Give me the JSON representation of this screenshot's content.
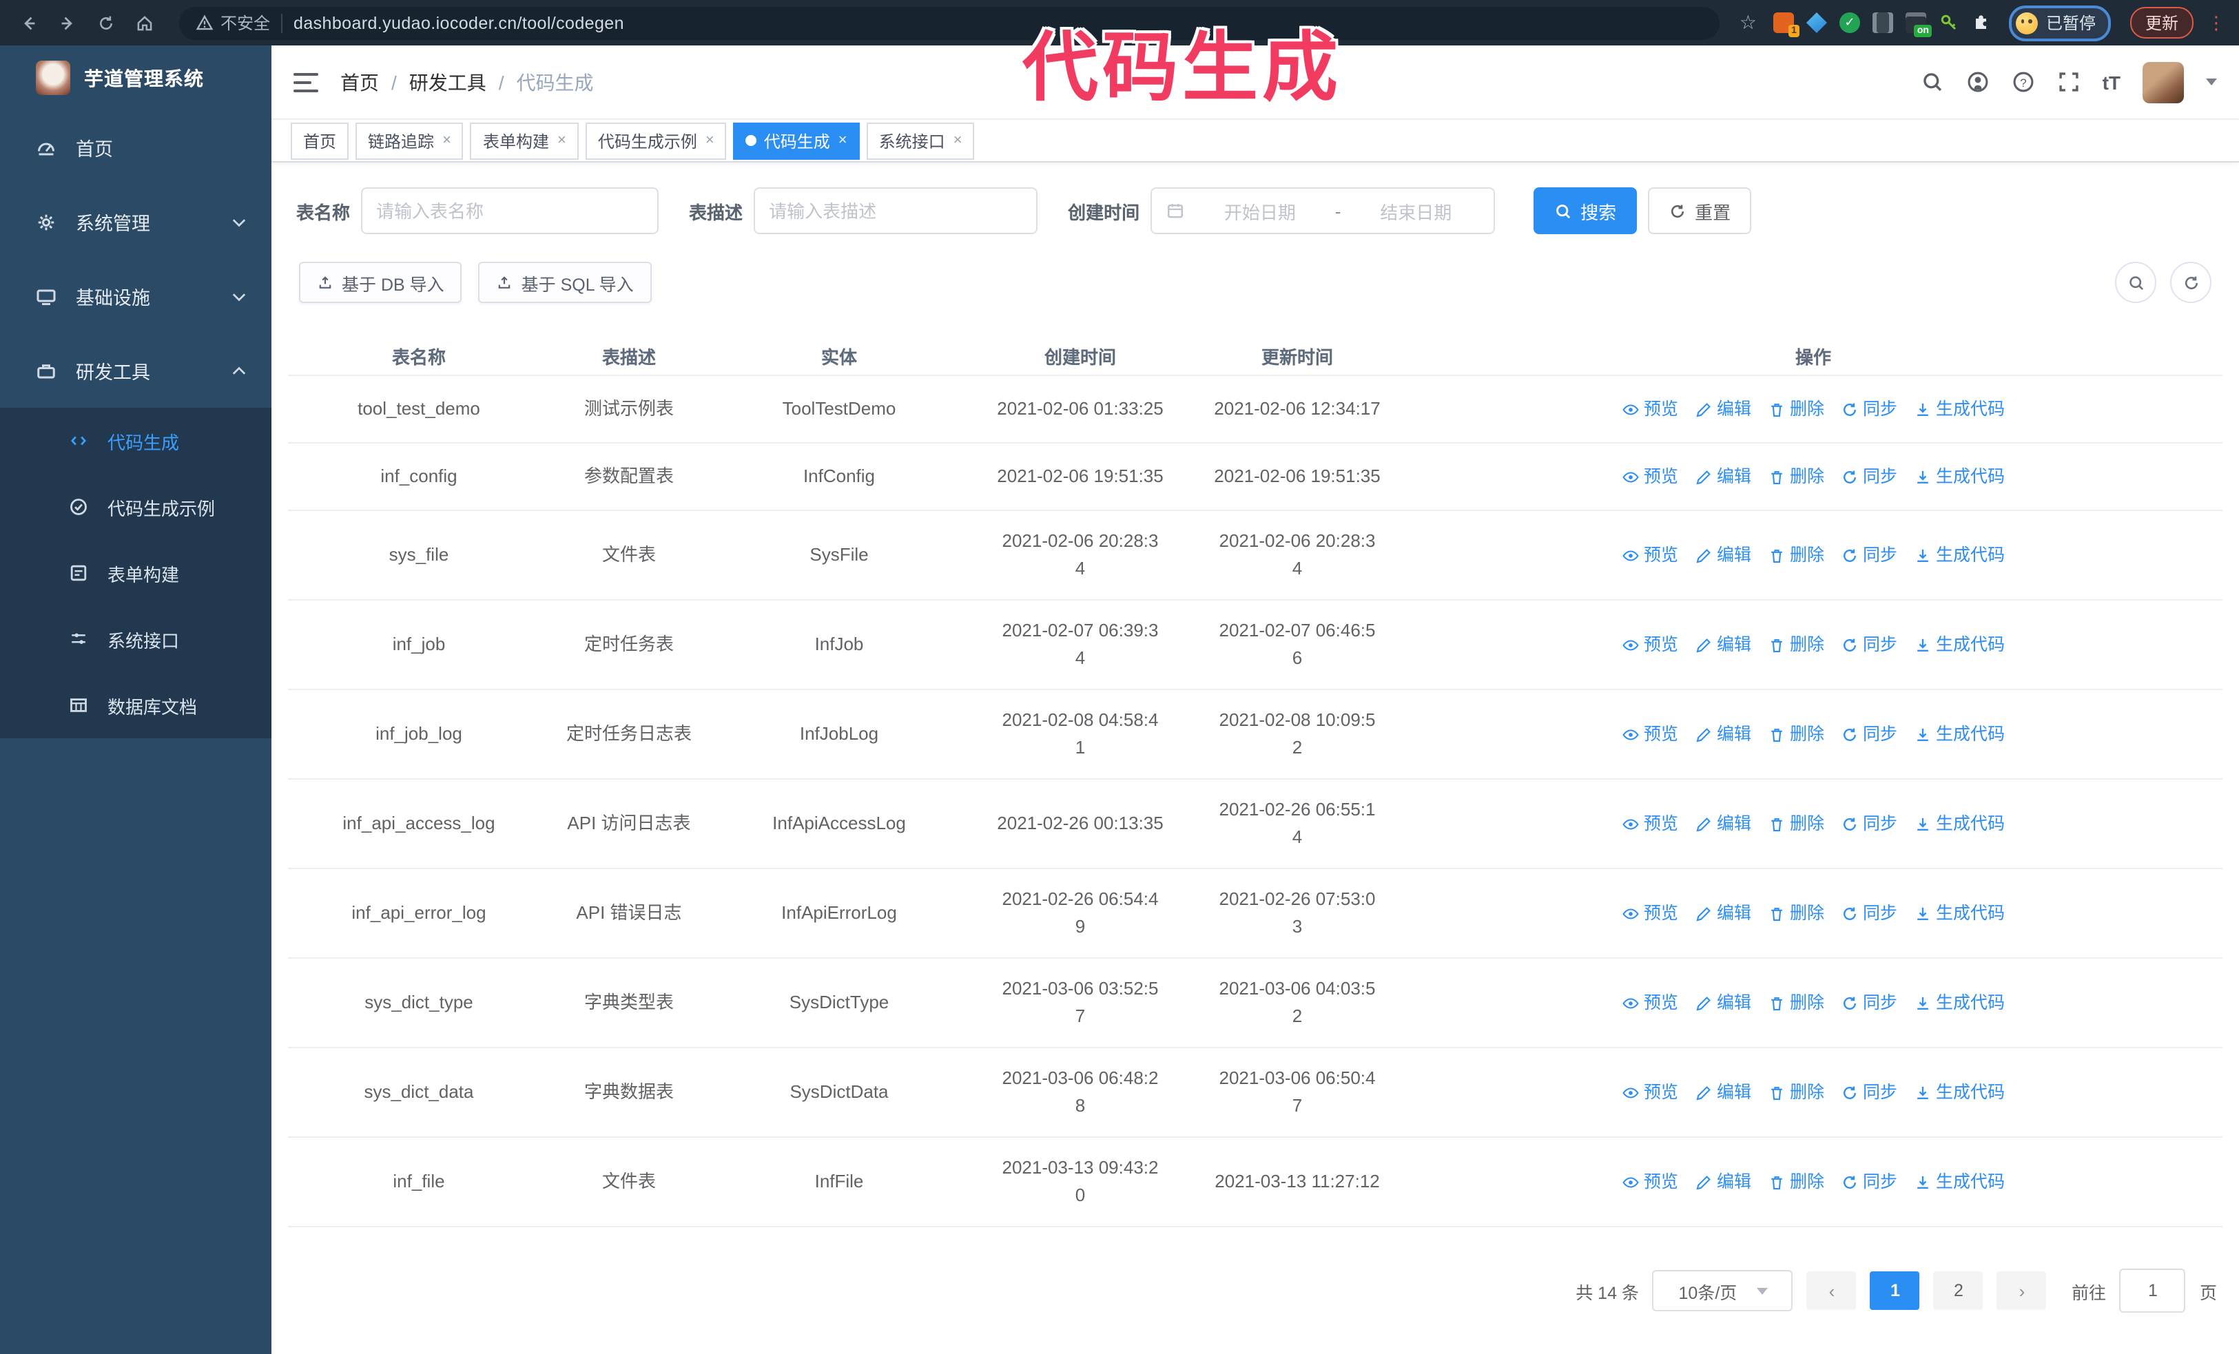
{
  "watermark": "代码生成",
  "browser": {
    "security_text": "不安全",
    "url": "dashboard.yudao.iocoder.cn/tool/codegen",
    "extension_badge": "1",
    "extension_on_badge": "on",
    "profile_label": "已暂停",
    "update_label": "更新"
  },
  "sidebar": {
    "app_title": "芋道管理系统",
    "items": [
      {
        "label": "首页",
        "icon": "dashboard-icon",
        "expandable": false
      },
      {
        "label": "系统管理",
        "icon": "gear-icon",
        "expandable": true,
        "state": "collapsed"
      },
      {
        "label": "基础设施",
        "icon": "monitor-icon",
        "expandable": true,
        "state": "collapsed"
      },
      {
        "label": "研发工具",
        "icon": "toolbox-icon",
        "expandable": true,
        "state": "expanded"
      }
    ],
    "submenu": [
      {
        "label": "代码生成",
        "icon": "code-icon",
        "active": true
      },
      {
        "label": "代码生成示例",
        "icon": "example-icon",
        "active": false
      },
      {
        "label": "表单构建",
        "icon": "form-icon",
        "active": false
      },
      {
        "label": "系统接口",
        "icon": "api-icon",
        "active": false
      },
      {
        "label": "数据库文档",
        "icon": "database-doc-icon",
        "active": false
      }
    ]
  },
  "navbar": {
    "breadcrumb": [
      "首页",
      "研发工具",
      "代码生成"
    ],
    "font_size_label": "tT"
  },
  "tags": [
    {
      "label": "首页",
      "active": false,
      "closable": false
    },
    {
      "label": "链路追踪",
      "active": false,
      "closable": true
    },
    {
      "label": "表单构建",
      "active": false,
      "closable": true
    },
    {
      "label": "代码生成示例",
      "active": false,
      "closable": true
    },
    {
      "label": "代码生成",
      "active": true,
      "closable": true
    },
    {
      "label": "系统接口",
      "active": false,
      "closable": true
    }
  ],
  "search": {
    "name_label": "表名称",
    "name_placeholder": "请输入表名称",
    "desc_label": "表描述",
    "desc_placeholder": "请输入表描述",
    "time_label": "创建时间",
    "start_placeholder": "开始日期",
    "range_separator": "-",
    "end_placeholder": "结束日期",
    "search_label": "搜索",
    "reset_label": "重置"
  },
  "toolbar": {
    "import_db_label": "基于 DB 导入",
    "import_sql_label": "基于 SQL 导入"
  },
  "table": {
    "columns": [
      "表名称",
      "表描述",
      "实体",
      "创建时间",
      "更新时间",
      "操作"
    ],
    "actions": [
      {
        "label": "预览",
        "icon": "eye-icon"
      },
      {
        "label": "编辑",
        "icon": "pencil-icon"
      },
      {
        "label": "删除",
        "icon": "trash-icon"
      },
      {
        "label": "同步",
        "icon": "sync-icon"
      },
      {
        "label": "生成代码",
        "icon": "download-icon"
      }
    ],
    "rows": [
      {
        "name": "tool_test_demo",
        "desc": "测试示例表",
        "entity": "ToolTestDemo",
        "created": "2021-02-06 01:33:25",
        "updated": "2021-02-06 12:34:17"
      },
      {
        "name": "inf_config",
        "desc": "参数配置表",
        "entity": "InfConfig",
        "created": "2021-02-06 19:51:35",
        "updated": "2021-02-06 19:51:35"
      },
      {
        "name": "sys_file",
        "desc": "文件表",
        "entity": "SysFile",
        "created": "2021-02-06 20:28:3\n4",
        "updated": "2021-02-06 20:28:3\n4"
      },
      {
        "name": "inf_job",
        "desc": "定时任务表",
        "entity": "InfJob",
        "created": "2021-02-07 06:39:3\n4",
        "updated": "2021-02-07 06:46:5\n6"
      },
      {
        "name": "inf_job_log",
        "desc": "定时任务日志表",
        "entity": "InfJobLog",
        "created": "2021-02-08 04:58:4\n1",
        "updated": "2021-02-08 10:09:5\n2"
      },
      {
        "name": "inf_api_access_log",
        "desc": "API 访问日志表",
        "entity": "InfApiAccessLog",
        "created": "2021-02-26 00:13:35",
        "updated": "2021-02-26 06:55:1\n4"
      },
      {
        "name": "inf_api_error_log",
        "desc": "API 错误日志",
        "entity": "InfApiErrorLog",
        "created": "2021-02-26 06:54:4\n9",
        "updated": "2021-02-26 07:53:0\n3"
      },
      {
        "name": "sys_dict_type",
        "desc": "字典类型表",
        "entity": "SysDictType",
        "created": "2021-03-06 03:52:5\n7",
        "updated": "2021-03-06 04:03:5\n2"
      },
      {
        "name": "sys_dict_data",
        "desc": "字典数据表",
        "entity": "SysDictData",
        "created": "2021-03-06 06:48:2\n8",
        "updated": "2021-03-06 06:50:4\n7"
      },
      {
        "name": "inf_file",
        "desc": "文件表",
        "entity": "InfFile",
        "created": "2021-03-13 09:43:2\n0",
        "updated": "2021-03-13 11:27:12"
      }
    ]
  },
  "pagination": {
    "total_label": "共 14 条",
    "page_size": "10条/页",
    "pages": [
      "1",
      "2"
    ],
    "active_page": "1",
    "goto_label": "前往",
    "goto_value": "1",
    "page_suffix": "页"
  },
  "colors": {
    "primary": "#2b8ef3",
    "sidebar_bg": "#2b4a66",
    "submenu_bg": "#22384e",
    "watermark": "#f23b60"
  }
}
